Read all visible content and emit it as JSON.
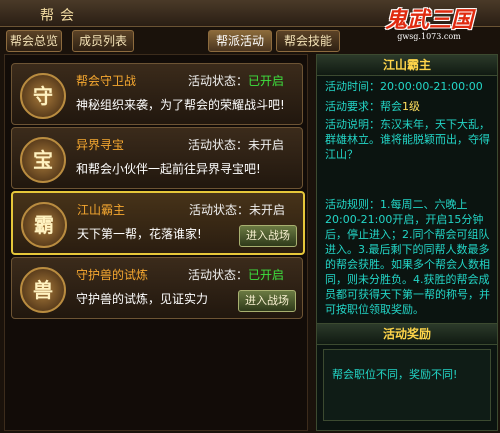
{
  "window": {
    "title": "帮会"
  },
  "logo": {
    "text": "鬼武三国",
    "url": "gwsg.1073.com"
  },
  "tabs": [
    {
      "label": "帮会总览",
      "active": false
    },
    {
      "label": "成员列表",
      "active": false
    },
    {
      "label": "帮派活动",
      "active": true
    },
    {
      "label": "帮会技能",
      "active": false
    }
  ],
  "activities": [
    {
      "name": "帮会守卫战",
      "status_label": "活动状态：",
      "status": "已开启",
      "desc": "神秘组织来袭，为了帮会的荣耀战斗吧!",
      "icon": "shield-guard-icon",
      "glyph": "守",
      "button": ""
    },
    {
      "name": "异界寻宝",
      "status_label": "活动状态：",
      "status": "未开启",
      "desc": "和帮会小伙伴一起前往异界寻宝吧!",
      "icon": "treasure-icon",
      "glyph": "宝",
      "button": ""
    },
    {
      "name": "江山霸主",
      "status_label": "活动状态：",
      "status": "未开启",
      "desc": "天下第一帮，花落谁家!",
      "icon": "dragon-throne-icon",
      "glyph": "霸",
      "button": "进入战场"
    },
    {
      "name": "守护兽的试炼",
      "status_label": "活动状态：",
      "status": "已开启",
      "desc": "守护兽的试炼，见证实力",
      "icon": "guardian-beast-icon",
      "glyph": "兽",
      "button": "进入战场"
    }
  ],
  "detail": {
    "title": "江山霸主",
    "time_label": "活动时间：",
    "time_value": "20:00:00-21:00:00",
    "requirement_label": "活动要求：帮会",
    "requirement_value": "1级",
    "description": "活动说明：东汉末年，天下大乱，群雄林立。谁将能脱颖而出，夺得江山？",
    "rules": "活动规则：1.每周二、六晚上20:00-21:00开启，开启15分钟后，停止进入；2.同个帮会可组队进入。3.最后剩下的同帮人数最多的帮会获胜。如果多个帮会人数相同，则未分胜负。4.获胜的帮会成员都可获得天下第一帮的称号，并可按职位领取奖励。",
    "reward_title": "活动奖励",
    "reward_text": "帮会职位不同，奖励不同!"
  },
  "colors": {
    "status_on": "#3ee03e",
    "status_off": "#f0f0f0",
    "name": "#f6a830",
    "info": "#23d6c7",
    "highlight": "#ffd54a"
  }
}
